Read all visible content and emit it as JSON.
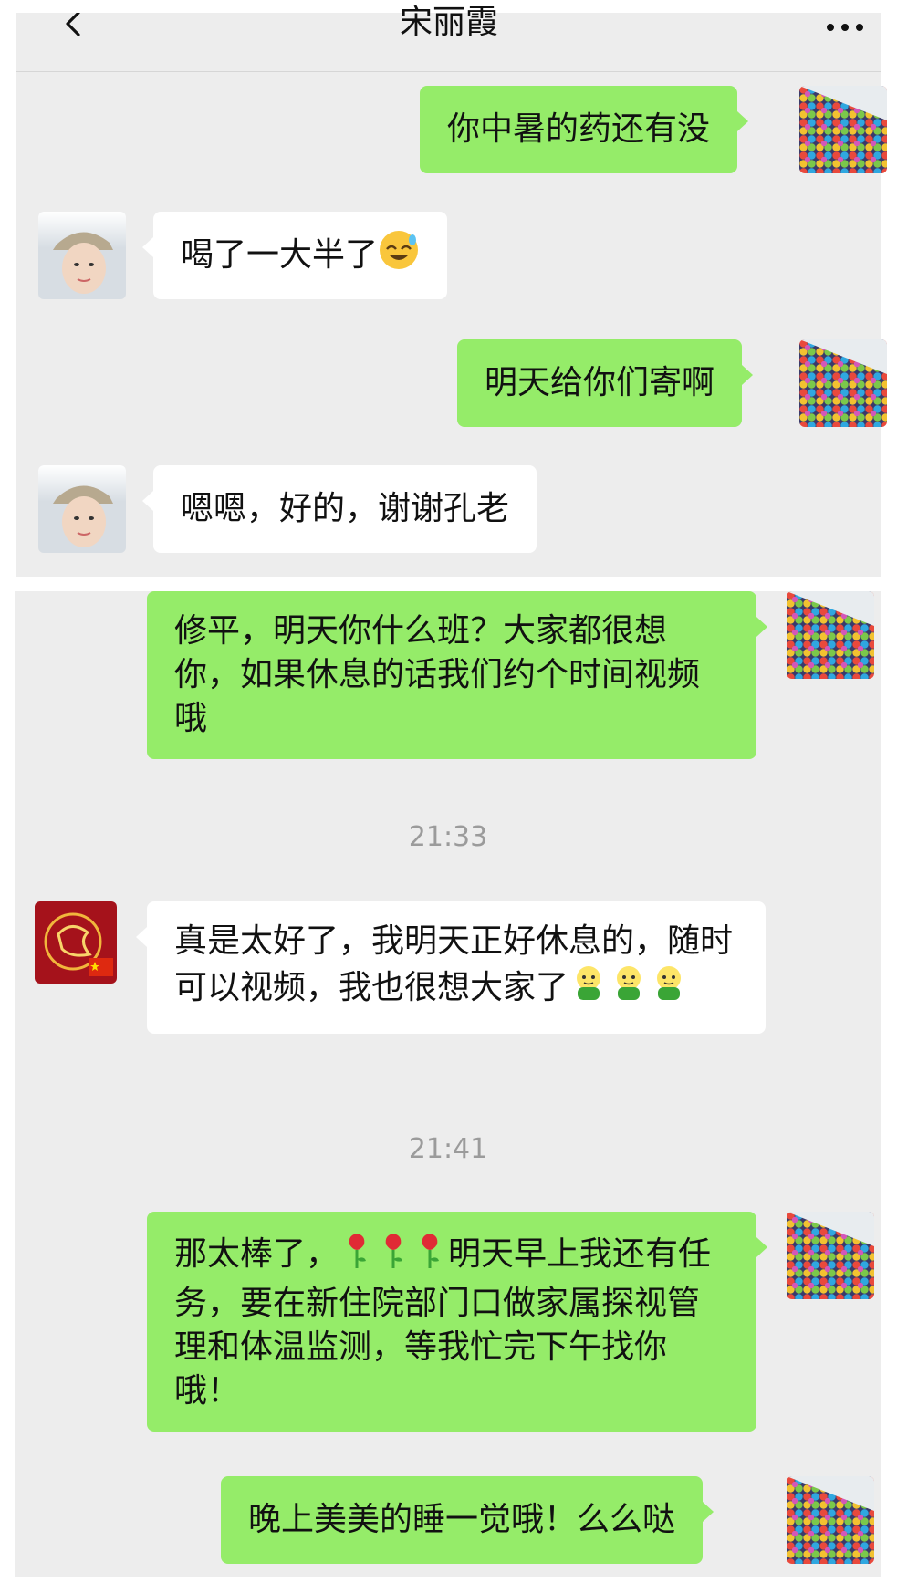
{
  "header": {
    "title": "宋丽霞",
    "back_icon": "chevron-left-icon",
    "more_icon": "ellipsis-icon"
  },
  "conversation_1": {
    "messages": [
      {
        "side": "out",
        "text": "你中暑的药还有没"
      },
      {
        "side": "in",
        "text": "喝了一大半了",
        "emoji": "grinning-sweat-icon"
      },
      {
        "side": "out",
        "text": "明天给你们寄啊"
      },
      {
        "side": "in",
        "text": "嗯嗯，好的，谢谢孔老"
      }
    ]
  },
  "conversation_2": {
    "messages": [
      {
        "side": "out",
        "text": "修平，明天你什么班？大家都很想你，如果休息的话我们约个时间视频哦"
      },
      {
        "side": "in",
        "text": "真是太好了，我明天正好休息的，随时可以视频，我也很想大家了",
        "emoji": "green-smiley-icon"
      },
      {
        "side": "out",
        "text_before": "那太棒了，",
        "text_after": "明天早上我还有任务，要在新住院部门口做家属探视管理和体温监测，等我忙完下午找你哦！",
        "emoji": "rose-icon"
      },
      {
        "side": "out",
        "text": "晚上美美的睡一觉哦！么么哒"
      }
    ],
    "timestamps": [
      "21:33",
      "21:41"
    ]
  },
  "colors": {
    "outgoing_bubble": "#95ec69",
    "incoming_bubble": "#ffffff",
    "chat_background": "#ededed",
    "timestamp_text": "#9b9b9b"
  }
}
